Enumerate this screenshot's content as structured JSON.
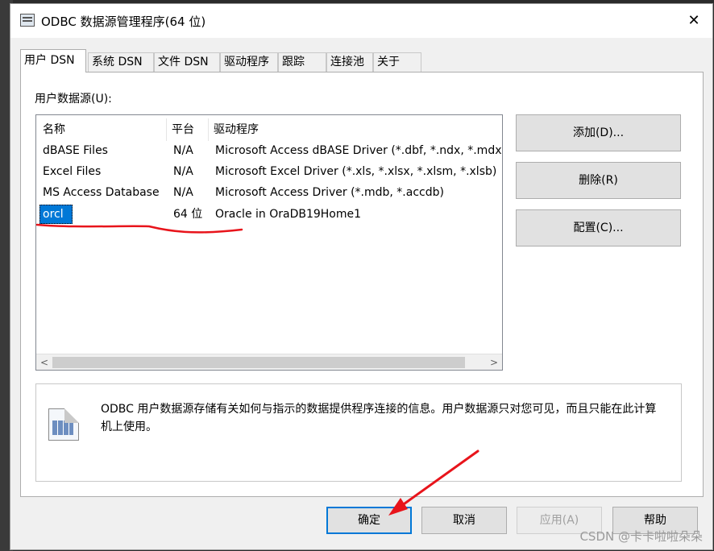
{
  "window": {
    "title": "ODBC 数据源管理程序(64 位)",
    "close_glyph": "✕",
    "app_icon": "odbc-app-icon"
  },
  "tabs": [
    {
      "label": "用户 DSN",
      "active": true
    },
    {
      "label": "系统 DSN",
      "active": false
    },
    {
      "label": "文件 DSN",
      "active": false
    },
    {
      "label": "驱动程序",
      "active": false
    },
    {
      "label": "跟踪",
      "active": false
    },
    {
      "label": "连接池",
      "active": false
    },
    {
      "label": "关于",
      "active": false
    }
  ],
  "user_dsn": {
    "section_label": "用户数据源(U):",
    "columns": [
      "名称",
      "平台",
      "驱动程序"
    ],
    "rows": [
      {
        "name": "dBASE Files",
        "platform": "N/A",
        "driver": "Microsoft Access dBASE Driver (*.dbf, *.ndx, *.mdx)"
      },
      {
        "name": "Excel Files",
        "platform": "N/A",
        "driver": "Microsoft Excel Driver (*.xls, *.xlsx, *.xlsm, *.xlsb)"
      },
      {
        "name": "MS Access Database",
        "platform": "N/A",
        "driver": "Microsoft Access Driver (*.mdb, *.accdb)"
      },
      {
        "name": "orcl",
        "platform": "64 位",
        "driver": "Oracle in OraDB19Home1",
        "selected": true
      }
    ],
    "scroll_left": "<",
    "scroll_right": ">"
  },
  "side_buttons": {
    "add": "添加(D)...",
    "remove": "删除(R)",
    "configure": "配置(C)..."
  },
  "info": {
    "text": "ODBC 用户数据源存储有关如何与指示的数据提供程序连接的信息。用户数据源只对您可见，而且只能在此计算机上使用。",
    "icon": "datasource-info-icon"
  },
  "bottom_buttons": {
    "ok": "确定",
    "cancel": "取消",
    "apply": "应用(A)",
    "help": "帮助"
  },
  "watermark": "CSDN @卡卡啦啦朵朵",
  "annotation_colors": {
    "underline": "#e8141b",
    "arrow": "#e8141b"
  },
  "colors": {
    "selection": "#0078d7",
    "dialog_bg": "#f0f0f0",
    "focus_border": "#0078d7"
  }
}
